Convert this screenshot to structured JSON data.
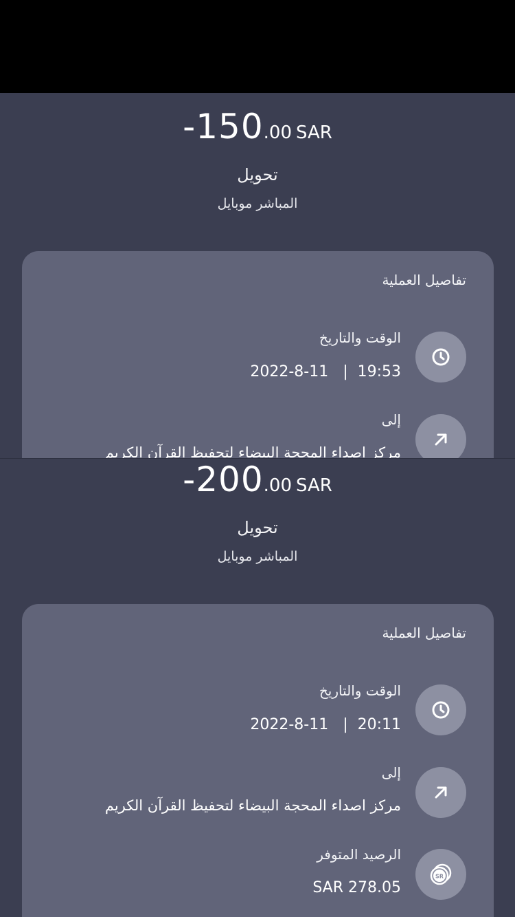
{
  "colors": {
    "panel_bg": "#3b3e51",
    "card_bg": "#616479",
    "icon_bg": "#8d90a2",
    "text": "#ffffff"
  },
  "transactions": [
    {
      "amount_int": "-150",
      "amount_dec": ".00",
      "currency": "SAR",
      "type": "تحويل",
      "channel": "المباشر موبايل",
      "details_title": "تفاصيل العملية",
      "datetime_label": "الوقت والتاريخ",
      "datetime_value": "2022-8-11   |  19:53",
      "to_label": "إلى",
      "to_value": "مركز اصداء المحجة البيضاء لتحفيظ القرآن الكريم",
      "icons": {
        "datetime": "clock-icon",
        "to": "arrow-up-right-icon"
      }
    },
    {
      "amount_int": "-200",
      "amount_dec": ".00",
      "currency": "SAR",
      "type": "تحويل",
      "channel": "المباشر موبايل",
      "details_title": "تفاصيل العملية",
      "datetime_label": "الوقت والتاريخ",
      "datetime_value": "2022-8-11   |  20:11",
      "to_label": "إلى",
      "to_value": "مركز اصداء المحجة البيضاء لتحفيظ القرآن الكريم",
      "balance_label": "الرصيد المتوفر",
      "balance_value": "SAR 278.05",
      "icons": {
        "datetime": "clock-icon",
        "to": "arrow-up-right-icon",
        "balance": "sar-coin-icon"
      }
    }
  ]
}
